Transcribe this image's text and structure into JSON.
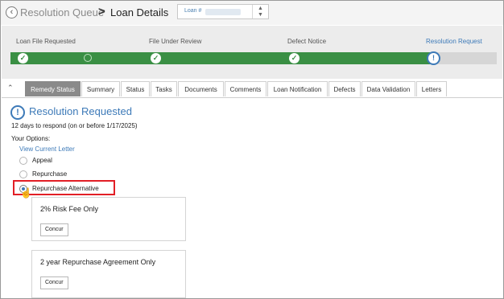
{
  "header": {
    "breadcrumb_queue": "Resolution Queue",
    "breadcrumb_separator": ">",
    "page_title": "Loan Details",
    "loan_select_label": "Loan #"
  },
  "progress": {
    "steps": [
      {
        "label": "Loan File Requested",
        "state": "complete"
      },
      {
        "label": "File Under Review",
        "state": "complete"
      },
      {
        "label": "Defect Notice",
        "state": "complete"
      },
      {
        "label": "Resolution Request",
        "state": "current"
      }
    ]
  },
  "tabs": [
    "Remedy Status",
    "Summary",
    "Status",
    "Tasks",
    "Documents",
    "Comments",
    "Loan Notification",
    "Defects",
    "Data Validation",
    "Letters"
  ],
  "active_tab": "Remedy Status",
  "status": {
    "title": "Resolution Requested",
    "respond_text": "12 days to respond (on or before 1/17/2025)"
  },
  "options": {
    "label": "Your Options:",
    "view_letter": "View Current Letter",
    "choices": [
      "Appeal",
      "Repurchase",
      "Repurchase Alternative"
    ],
    "selected": "Repurchase Alternative"
  },
  "alternatives": [
    {
      "title": "2% Risk Fee Only",
      "button": "Concur"
    },
    {
      "title": "2 year Repurchase Agreement Only",
      "button": "Concur"
    }
  ],
  "colors": {
    "accent_blue": "#3d7ab8",
    "progress_green": "#3a8f44",
    "highlight_red": "#e21f26",
    "active_tab_gray": "#8a8a8a"
  }
}
